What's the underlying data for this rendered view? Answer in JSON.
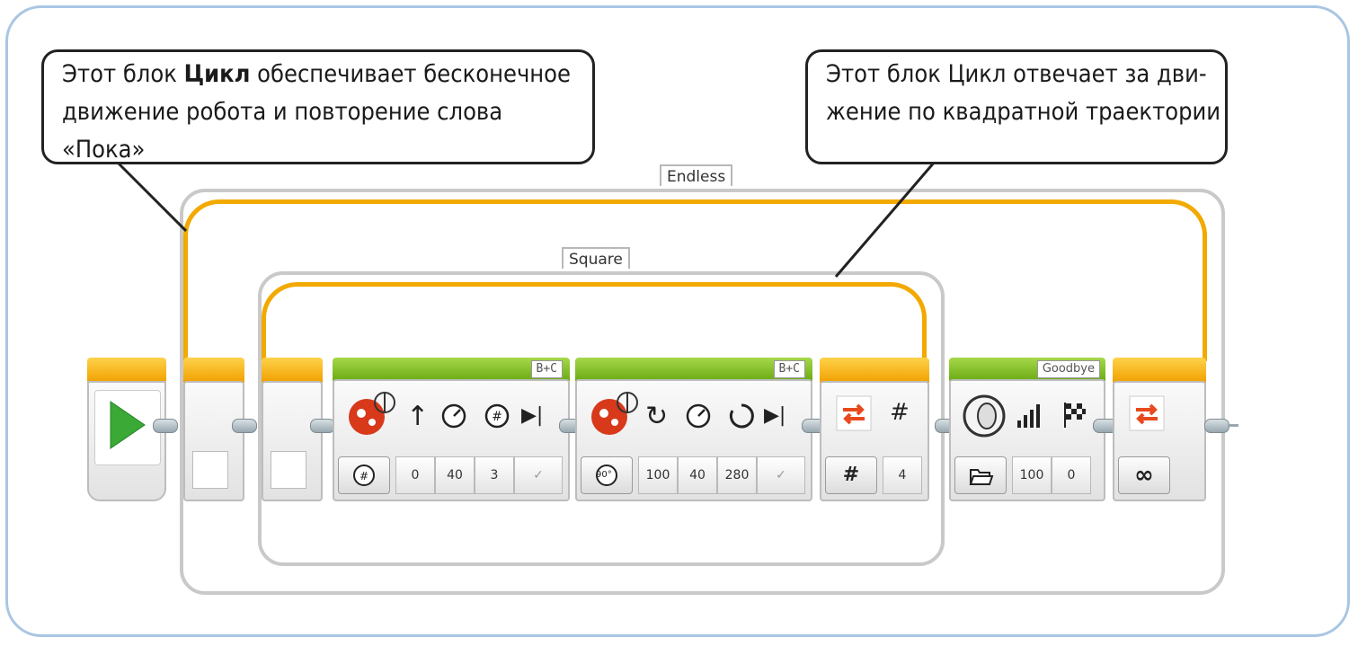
{
  "callouts": {
    "left": {
      "line1_pre": "Этот блок ",
      "line1_bold": "Цикл",
      "line1_post": " обеспечивает бесконечное",
      "line2": "движение робота и повторение слова «Пока»"
    },
    "right": {
      "line1": "Этот блок Цикл отвечает за дви-",
      "line2": "жение по квадратной траектории"
    }
  },
  "loops": {
    "outer": {
      "label": "Endless"
    },
    "inner": {
      "label": "Square"
    }
  },
  "blocks": {
    "start": {
      "icon": "play-triangle-icon"
    },
    "move_steering_1": {
      "ports": "B+C",
      "mode_icon": "rotations-mode-icon",
      "values": [
        "0",
        "40",
        "3",
        "✓"
      ]
    },
    "move_steering_2": {
      "ports": "B+C",
      "mode_icon": "degrees-mode-icon",
      "mode_text": "90°",
      "values": [
        "100",
        "40",
        "280",
        "✓"
      ]
    },
    "loop_count": {
      "mode_text": "#",
      "header_symbol": "#",
      "value": "4"
    },
    "sound": {
      "file": "Goodbye",
      "values": [
        "100",
        "0"
      ]
    },
    "loop_endless": {
      "mode_text": "∞"
    }
  },
  "colors": {
    "frame": "#a9c6e3",
    "loop_wire": "#f2a900",
    "action_block": "#7fbf1e",
    "flow_block": "#f0a000",
    "start": "#3aa935",
    "loop_icon": "#e8491d"
  }
}
